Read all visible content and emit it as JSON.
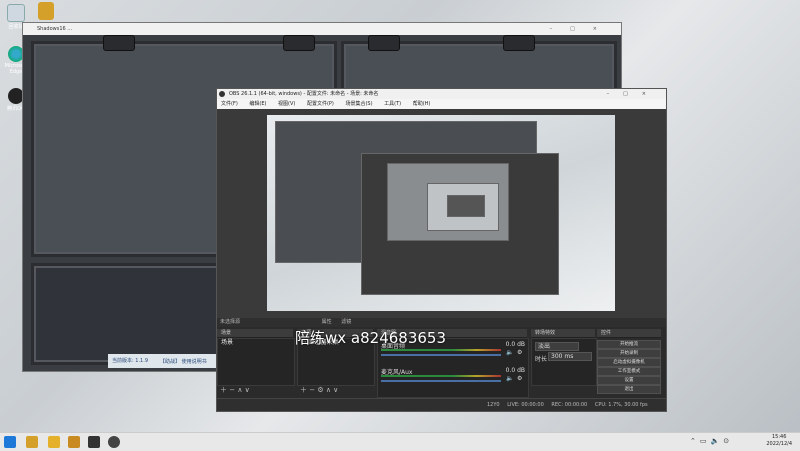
{
  "desktop": {
    "icons": [
      {
        "label": "回收站"
      },
      {
        "label": "Microsoft Edge"
      },
      {
        "label": "腾讯QQ"
      }
    ]
  },
  "background_window": {
    "title": "Shadows16 ...",
    "status_text": "当前版本: 1.1.9",
    "status_text2": "【助战】 使用说明书"
  },
  "obs": {
    "title": "OBS 26.1.1 (64-bit, windows) - 配置文件: 未命名 - 场景: 未命名",
    "menu": [
      "文件(F)",
      "编辑(E)",
      "视图(V)",
      "配置文件(P)",
      "场景集合(S)",
      "工具(T)",
      "帮助(H)"
    ],
    "source_toolbar_label": "未选择源",
    "source_tab_properties": "属性",
    "source_tab_filters": "滤镜",
    "docks": {
      "scenes": {
        "header": "场景",
        "items": [
          "场景"
        ]
      },
      "sources": {
        "header": "来源",
        "items": [
          "显示器采集"
        ]
      },
      "mixer": {
        "header": "混音器",
        "channels": [
          {
            "name": "桌面音频",
            "db": "0.0 dB"
          },
          {
            "name": "麦克风/Aux",
            "db": "0.0 dB"
          }
        ]
      },
      "transitions": {
        "header": "转场特效",
        "type": "淡出",
        "duration_label": "时长",
        "duration_value": "300 ms"
      },
      "controls": {
        "header": "控件",
        "buttons": [
          "开始推流",
          "开始录制",
          "启动虚拟摄像机",
          "工作室模式",
          "设置",
          "退出"
        ]
      }
    },
    "status": {
      "live": "LIVE: 00:00:00",
      "rec": "REC: 00:00:00",
      "cpu": "CPU: 1.7%, 30.00 fps",
      "drop": "12Y0"
    }
  },
  "watermark": "陪练wx a824683653",
  "taskbar": {
    "time": "15:46",
    "date": "2022/12/4"
  }
}
